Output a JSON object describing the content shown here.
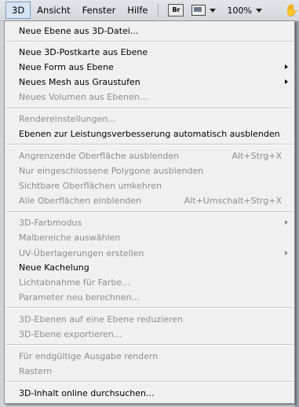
{
  "menubar": {
    "items": [
      {
        "label": "3D"
      },
      {
        "label": "Ansicht"
      },
      {
        "label": "Fenster"
      },
      {
        "label": "Hilfe"
      }
    ],
    "bridge_label": "Br",
    "zoom": "100%"
  },
  "menu": {
    "items": [
      {
        "label": "Neue Ebene aus 3D-Datei...",
        "shortcut": "",
        "disabled": false,
        "submenu": false
      },
      {
        "label": "Neue 3D-Postkarte aus Ebene",
        "shortcut": "",
        "disabled": false,
        "submenu": false
      },
      {
        "label": "Neue Form aus Ebene",
        "shortcut": "",
        "disabled": false,
        "submenu": true
      },
      {
        "label": "Neues Mesh aus Graustufen",
        "shortcut": "",
        "disabled": false,
        "submenu": true
      },
      {
        "label": "Neues Volumen aus Ebenen...",
        "shortcut": "",
        "disabled": true,
        "submenu": false
      },
      {
        "label": "Rendereinstellungen...",
        "shortcut": "",
        "disabled": true,
        "submenu": false
      },
      {
        "label": "Ebenen zur Leistungsverbesserung automatisch ausblenden",
        "shortcut": "",
        "disabled": false,
        "submenu": false
      },
      {
        "label": "Angrenzende Oberfläche ausblenden",
        "shortcut": "Alt+Strg+X",
        "disabled": true,
        "submenu": false
      },
      {
        "label": "Nur eingeschlossene Polygone ausblenden",
        "shortcut": "",
        "disabled": true,
        "submenu": false
      },
      {
        "label": "Sichtbare Oberflächen umkehren",
        "shortcut": "",
        "disabled": true,
        "submenu": false
      },
      {
        "label": "Alle Oberflächen einblenden",
        "shortcut": "Alt+Umschalt+Strg+X",
        "disabled": true,
        "submenu": false
      },
      {
        "label": "3D-Farbmodus",
        "shortcut": "",
        "disabled": true,
        "submenu": true
      },
      {
        "label": "Malbereiche auswählen",
        "shortcut": "",
        "disabled": true,
        "submenu": false
      },
      {
        "label": "UV-Überlagerungen erstellen",
        "shortcut": "",
        "disabled": true,
        "submenu": true
      },
      {
        "label": "Neue Kachelung",
        "shortcut": "",
        "disabled": false,
        "submenu": false
      },
      {
        "label": "Lichtabnahme für Farbe...",
        "shortcut": "",
        "disabled": true,
        "submenu": false
      },
      {
        "label": "Parameter neu berechnen...",
        "shortcut": "",
        "disabled": true,
        "submenu": false
      },
      {
        "label": "3D-Ebenen auf eine Ebene reduzieren",
        "shortcut": "",
        "disabled": true,
        "submenu": false
      },
      {
        "label": "3D-Ebene exportieren...",
        "shortcut": "",
        "disabled": true,
        "submenu": false
      },
      {
        "label": "Für endgültige Ausgabe rendern",
        "shortcut": "",
        "disabled": true,
        "submenu": false
      },
      {
        "label": "Rastern",
        "shortcut": "",
        "disabled": true,
        "submenu": false
      },
      {
        "label": "3D-Inhalt online durchsuchen...",
        "shortcut": "",
        "disabled": false,
        "submenu": false
      }
    ]
  }
}
